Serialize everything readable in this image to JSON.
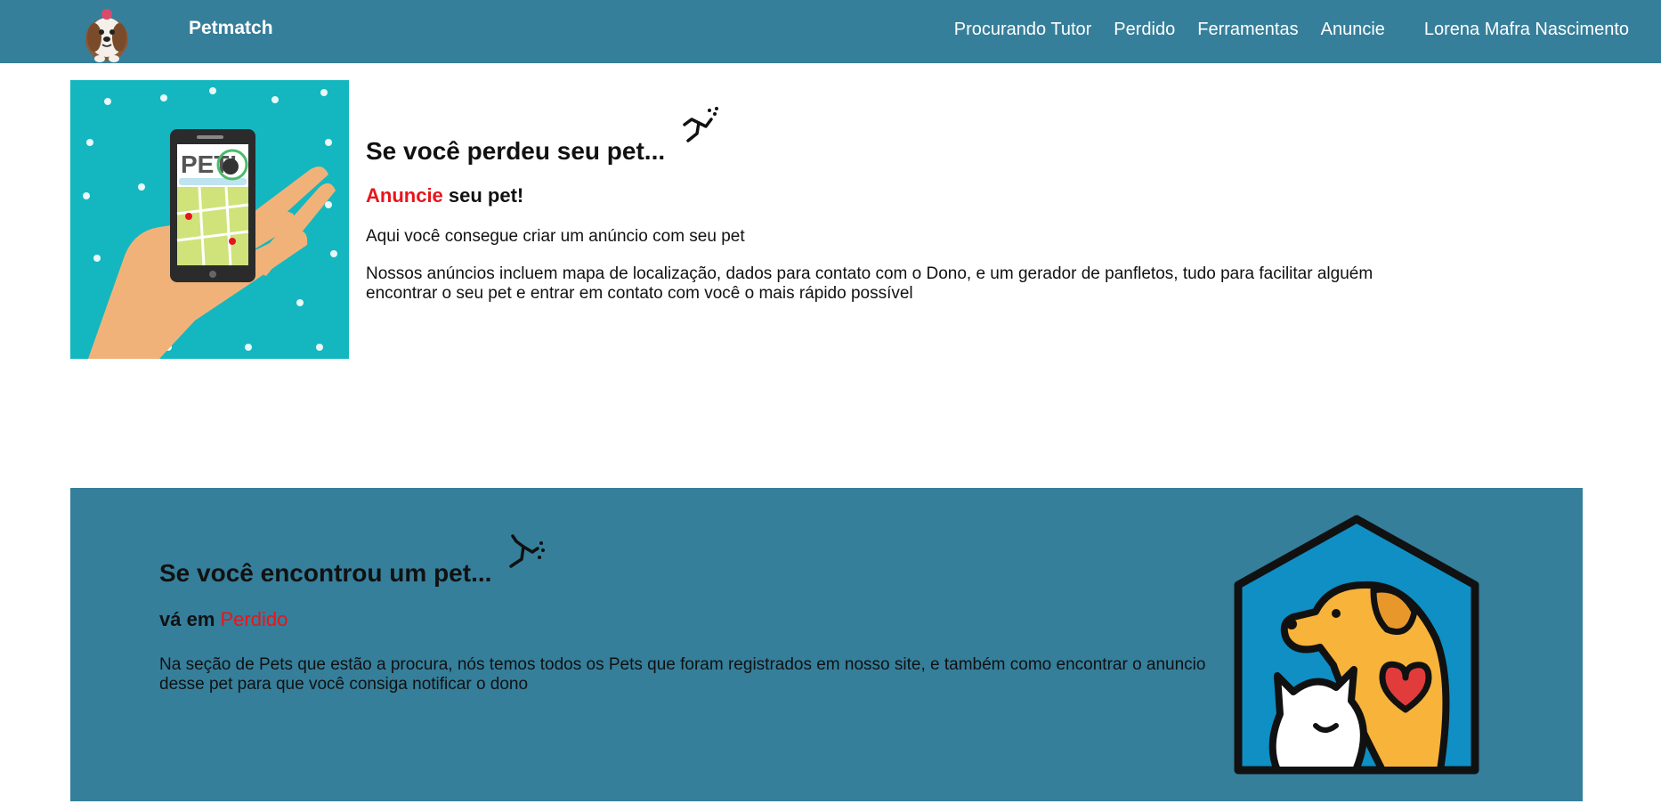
{
  "nav": {
    "brand": "Petmatch",
    "links": [
      {
        "label": "Procurando Tutor"
      },
      {
        "label": "Perdido"
      },
      {
        "label": "Ferramentas"
      },
      {
        "label": "Anuncie"
      }
    ],
    "user": "Lorena Mafra Nascimento"
  },
  "lost": {
    "title": "Se você perdeu seu pet...",
    "subtitle_highlight": "Anuncie",
    "subtitle_rest": " seu pet!",
    "paragraph1": "Aqui você consegue criar um anúncio com seu pet",
    "paragraph2": "Nossos anúncios incluem mapa de localização, dados para contato com o Dono, e um gerador de panfletos, tudo para facilitar alguém encontrar o seu pet e entrar em contato com você o mais rápido possível",
    "phone_logo_text": "PET!"
  },
  "found": {
    "title": "Se você encontrou um pet...",
    "subtitle_prefix": "vá em ",
    "subtitle_link": "Perdido",
    "paragraph": "Na seção de Pets que estão a procura, nós temos todos os Pets que foram registrados em nosso site, e também como encontrar o anuncio desse pet para que você consiga notificar o dono"
  },
  "colors": {
    "navbar": "#357f9b",
    "highlight_red": "#e8151b",
    "teal_bg": "#14b7bf"
  },
  "icons": [
    "dog-logo-icon",
    "runner-icon",
    "pets-house-icon",
    "phone-map-illustration"
  ]
}
